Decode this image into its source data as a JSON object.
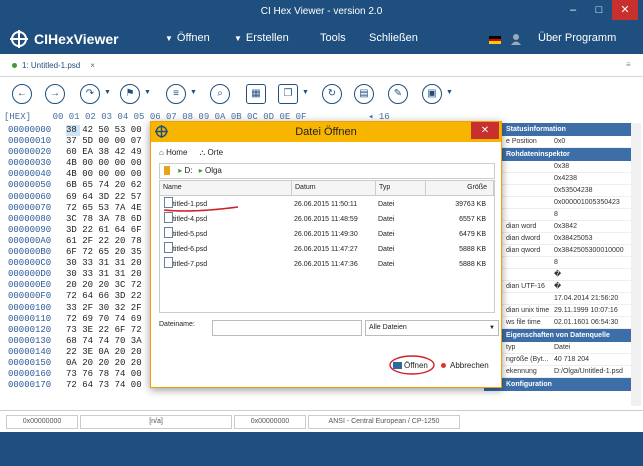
{
  "window": {
    "title": "CI Hex Viewer - version 2.0",
    "minimize": "–",
    "maximize": "□",
    "close": "✕"
  },
  "menubar": {
    "appname": "CIHexViewer",
    "items": [
      {
        "label": "Öffnen",
        "arrow": "▼"
      },
      {
        "label": "Erstellen",
        "arrow": "▼"
      },
      {
        "label": "Tools"
      },
      {
        "label": "Schließen"
      }
    ],
    "about": "Über Programm"
  },
  "tabs": [
    {
      "label": "1: Untitled-1.psd",
      "close": "×"
    }
  ],
  "toolbar": {
    "page_box": "16"
  },
  "hex": {
    "header": "[HEX]    00 01 02 03 04 05 06 07 08 09 0A 0B 0C 0D 0E 0F",
    "offsets": [
      "00000000",
      "00000010",
      "00000020",
      "00000030",
      "00000040",
      "00000050",
      "00000060",
      "00000070",
      "00000080",
      "00000090",
      "000000A0",
      "000000B0",
      "000000C0",
      "000000D0",
      "000000E0",
      "000000F0",
      "00000100",
      "00000110",
      "00000120",
      "00000130",
      "00000140",
      "00000150",
      "00000160",
      "00000170"
    ],
    "bytes": [
      "38 42 50 53 00",
      "37 5D 00 00 07",
      "60 EA 38 42 49",
      "4B 00 00 00 00",
      "4B 00 00 00 00",
      "6B 65 74 20 62",
      "69 64 3D 22 57",
      "72 65 53 7A 4E",
      "3C 78 3A 78 6D",
      "3D 22 61 64 6F",
      "61 2F 22 20 78",
      "6F 72 65 20 35",
      "30 33 31 31 20",
      "30 33 31 31 20",
      "20 20 20 3C 72",
      "72 64 66 3D 22",
      "33 2F 30 32 2F",
      "72 69 70 74 69",
      "73 3E 22 6F 72",
      "68 74 74 70 3A",
      "22 3E 0A 20 20",
      "0A 20 20 20 20",
      "73 76 78 74 00",
      "72 64 73 74 00"
    ]
  },
  "rightpanel": {
    "sections": [
      {
        "title": "Statusinformation",
        "rows": [
          {
            "label": "e Position",
            "value": "0x0"
          }
        ]
      },
      {
        "title": "Rohdateninspektor",
        "rows": [
          {
            "label": "",
            "value": "0x38"
          },
          {
            "label": "",
            "value": "0x4238"
          },
          {
            "label": "",
            "value": "0x53504238"
          },
          {
            "label": "",
            "value": "0x000001005350423"
          },
          {
            "label": "",
            "value": "8"
          },
          {
            "label": "dian word",
            "value": "0x3842"
          },
          {
            "label": "dian dword",
            "value": "0x38425053"
          },
          {
            "label": "dian qword",
            "value": "0x3842505300010000"
          },
          {
            "label": "",
            "value": "8"
          },
          {
            "label": "",
            "value": "�"
          },
          {
            "label": "dian UTF-16",
            "value": "�"
          },
          {
            "label": "",
            "value": "17.04.2014 21:56:20"
          },
          {
            "label": "dian unix time",
            "value": "29.11.1999 10:07:16"
          },
          {
            "label": "ws file time",
            "value": "02.01.1601 06:54:30"
          }
        ]
      },
      {
        "title": "Eigenschaften von Datenquelle",
        "rows": [
          {
            "label": "typ",
            "value": "Datei"
          },
          {
            "label": "ngröße (Byt...",
            "value": "40 718 204"
          },
          {
            "label": "ekennung",
            "value": "D:/Olga/Untitled-1.psd"
          }
        ]
      },
      {
        "title": "Konfiguration",
        "rows": []
      }
    ]
  },
  "statusbar": {
    "offset": "0x00000000",
    "na": "[n/a]",
    "offset2": "0x00000000",
    "encoding": "ANSI - Central European / CP-1250"
  },
  "dialog": {
    "title": "Datei Öffnen",
    "home": "Home",
    "orte": "Orte",
    "path": [
      "D:",
      "Olga"
    ],
    "columns": [
      "Name",
      "Datum",
      "Typ",
      "Größe"
    ],
    "files": [
      {
        "name": "Untitled-1.psd",
        "date": "26.06.2015 11:50:11",
        "type": "Datei",
        "size": "39763 KB"
      },
      {
        "name": "Untitled-4.psd",
        "date": "26.06.2015 11:48:59",
        "type": "Datei",
        "size": "6557 KB"
      },
      {
        "name": "Untitled-5.psd",
        "date": "26.06.2015 11:49:30",
        "type": "Datei",
        "size": "6479 KB"
      },
      {
        "name": "Untitled-6.psd",
        "date": "26.06.2015 11:47:27",
        "type": "Datei",
        "size": "5888 KB"
      },
      {
        "name": "Untitled-7.psd",
        "date": "26.06.2015 11:47:36",
        "type": "Datei",
        "size": "5888 KB"
      }
    ],
    "filename_label": "Dateiname:",
    "filename_value": "",
    "filter": "Alle Dateien",
    "open": "Öffnen",
    "cancel": "Abbrechen"
  },
  "colors": {
    "primary": "#1e4f7e",
    "dialog_title": "#f7b500",
    "annotation": "#d0202a"
  }
}
